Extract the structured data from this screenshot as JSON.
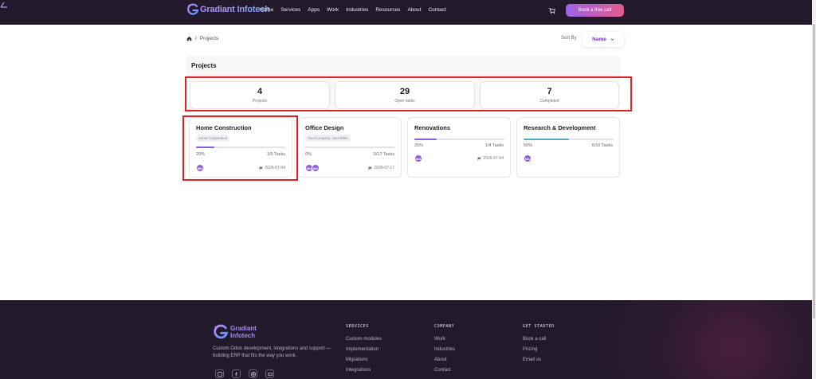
{
  "brand": {
    "name": "Gradiant Infotech"
  },
  "nav": {
    "links": [
      "Home",
      "Services",
      "Apps",
      "Work",
      "Industries",
      "Resources",
      "About",
      "Contact"
    ],
    "cta": "Book a free call"
  },
  "breadcrumb": {
    "separator": "/",
    "current": "Projects"
  },
  "sort": {
    "label": "Sort By",
    "value": "Name"
  },
  "panel": {
    "title": "Projects",
    "stats": [
      {
        "value": "4",
        "label": "Projects"
      },
      {
        "value": "29",
        "label": "Open tasks"
      },
      {
        "value": "7",
        "label": "Completed"
      }
    ]
  },
  "projects": [
    {
      "title": "Home Construction",
      "client": "Acme Corporation",
      "progress_pct": 20,
      "percent": "20%",
      "tasks": "1/5 Tasks",
      "avatars": [
        "MD"
      ],
      "date": "2026-07-04",
      "bar_color": "#8a5ce0"
    },
    {
      "title": "Office Design",
      "client": "YourCompany, Joel Willis",
      "progress_pct": 0,
      "percent": "0%",
      "tasks": "0/17 Tasks",
      "avatars": [
        "MD",
        "MA"
      ],
      "date": "2026-07-17",
      "bar_color": "#8a5ce0"
    },
    {
      "title": "Renovations",
      "client": "",
      "progress_pct": 25,
      "percent": "25%",
      "tasks": "1/4 Tasks",
      "avatars": [
        "MA"
      ],
      "date": "2026-07-04",
      "bar_color": "#8a5ce0"
    },
    {
      "title": "Research & Development",
      "client": "",
      "progress_pct": 50,
      "percent": "50%",
      "tasks": "5/10 Tasks",
      "avatars": [
        "MA"
      ],
      "date": "",
      "bar_color": "#5aa9c9"
    }
  ],
  "footer": {
    "brand_line1": "Gradiant",
    "brand_line2": "Infotech",
    "description": "Custom Odoo development, integrations and support — building ERP that fits the way you work.",
    "services": {
      "heading": "SERVICES",
      "links": [
        "Custom modules",
        "Implementation",
        "Migrations",
        "Integrations"
      ]
    },
    "company": {
      "heading": "COMPANY",
      "links": [
        "Work",
        "Industries",
        "About",
        "Contact"
      ]
    },
    "get_started": {
      "heading": "GET STARTED",
      "links": [
        "Book a call",
        "Pricing",
        "Email us"
      ]
    }
  }
}
